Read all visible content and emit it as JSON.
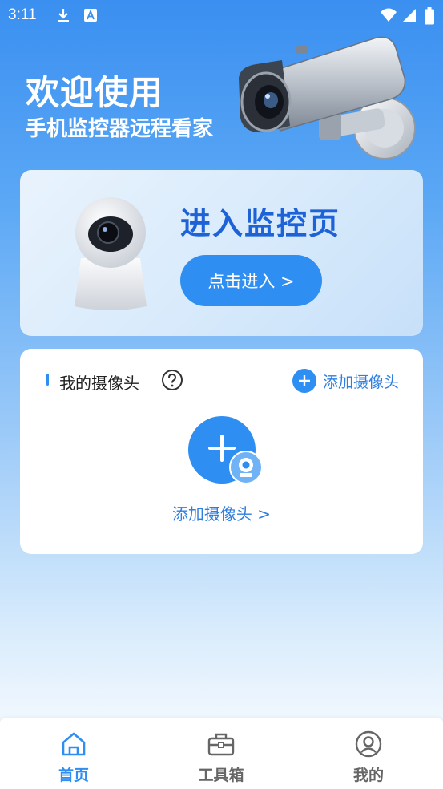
{
  "status_bar": {
    "time": "3:11"
  },
  "hero": {
    "title": "欢迎使用",
    "subtitle": "手机监控器远程看家"
  },
  "banner": {
    "title": "进入监控页",
    "button_label": "点击进入 >"
  },
  "cameras": {
    "section_title": "我的摄像头",
    "add_link_label": "添加摄像头",
    "empty_add_label": "添加摄像头 >"
  },
  "tabbar": {
    "tabs": [
      {
        "label": "首页",
        "icon": "home-icon",
        "active": true
      },
      {
        "label": "工具箱",
        "icon": "toolbox-icon",
        "active": false
      },
      {
        "label": "我的",
        "icon": "profile-icon",
        "active": false
      }
    ]
  },
  "colors": {
    "accent": "#2f8ef1",
    "banner_title": "#1d62d6",
    "link": "#2f7ee0"
  }
}
